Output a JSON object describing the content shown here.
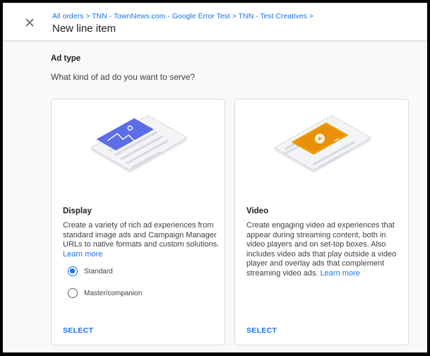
{
  "header": {
    "close_icon": "close-icon",
    "breadcrumb": "All orders > TNN - TownNews.com - Google Error Test > TNN - Test Creatives >",
    "title": "New line item"
  },
  "ad_type": {
    "title": "Ad type",
    "question": "What kind of ad do you want to serve?"
  },
  "cards": {
    "display": {
      "title": "Display",
      "description": "Create a variety of rich ad experiences from standard image ads and Campaign Manager URLs to native formats and custom solutions.",
      "learn_more": "Learn more",
      "options": [
        {
          "label": "Standard",
          "selected": true
        },
        {
          "label": "Master/companion",
          "selected": false
        }
      ],
      "select_label": "SELECT",
      "accent_color": "#5b6ee8"
    },
    "video": {
      "title": "Video",
      "description": "Create engaging video ad experiences that appear during streaming content, both in video players and on set-top boxes. Also includes video ads that play outside a video player and overlay ads that complement streaming video ads.",
      "learn_more": "Learn more",
      "select_label": "SELECT",
      "accent_color": "#f29900"
    }
  },
  "colors": {
    "link": "#1a73e8",
    "background": "#f8f9fa"
  }
}
